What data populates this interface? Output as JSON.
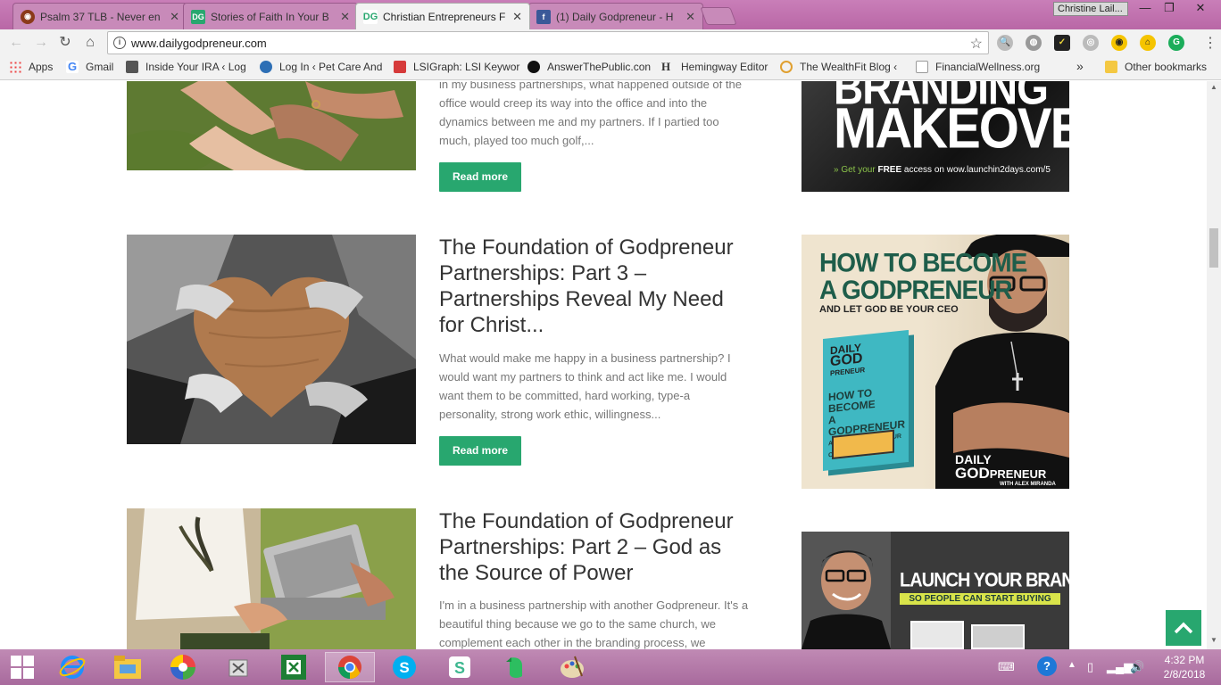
{
  "browser": {
    "tabs": [
      {
        "label": "Psalm 37 TLB - Never en",
        "active": false
      },
      {
        "label": "Stories of Faith In Your B",
        "active": false
      },
      {
        "label": "Christian Entrepreneurs F",
        "active": true
      },
      {
        "label": "(1) Daily Godpreneur - H",
        "active": false
      }
    ],
    "tab_icons": [
      "book-icon",
      "dg-icon",
      "dg-icon",
      "facebook-icon"
    ],
    "profile_name": "Christine Lail...",
    "window_controls": {
      "minimize": "—",
      "restore": "❐",
      "close": "✕"
    },
    "url": "www.dailygodpreneur.com",
    "bookmarks": [
      {
        "label": "Apps"
      },
      {
        "label": "Gmail"
      },
      {
        "label": "Inside Your IRA ‹ Log"
      },
      {
        "label": "Log In ‹ Pet Care And"
      },
      {
        "label": "LSIGraph: LSI Keywor"
      },
      {
        "label": "AnswerThePublic.con"
      },
      {
        "label": "Hemingway Editor"
      },
      {
        "label": "The WealthFit Blog ‹"
      },
      {
        "label": "FinancialWellness.org"
      }
    ],
    "bookmarks_overflow": "»",
    "other_bookmarks": "Other bookmarks"
  },
  "posts": [
    {
      "title": "",
      "excerpt": "in my business partnerships, what happened outside of the office would creep its way into the office and into the dynamics between me and my partners. If I partied too much, played too much golf,...",
      "read_more": "Read more"
    },
    {
      "title": "The Foundation of Godpreneur Partnerships: Part 3 – Partnerships Reveal My Need for Christ...",
      "excerpt": "What would make me happy in a business partnership? I would want my partners to think and act like me. I would want them to be committed, hard working, type-a personality, strong work ethic, willingness...",
      "read_more": "Read more"
    },
    {
      "title": "The Foundation of Godpreneur Partnerships: Part 2 – God as the Source of Power",
      "excerpt": "I'm in a business partnership with another Godpreneur. It's a beautiful thing because we go to the same church, we complement each other in the branding process, we",
      "read_more": ""
    }
  ],
  "ads": [
    {
      "headline_top": "BRANDING",
      "headline": "MAKEOVER",
      "cta_prefix": "» Get your ",
      "cta_bold": "FREE",
      "cta_suffix": " access on wow.launchin2days.com/5"
    },
    {
      "line1": "HOW TO BECOME",
      "line2": "A GODPRENEUR",
      "line3": "AND LET GOD BE YOUR CEO",
      "book_top": "DAILY",
      "book_mid": "GOD",
      "book_small": "PRENEUR",
      "book_title1": "HOW TO BECOME",
      "book_title2": "A GODPRENEUR",
      "book_sub": "AND LET GOD BE YOUR CEO",
      "logo_top": "DAILY",
      "logo_bottom_a": "GOD",
      "logo_bottom_b": "PRENEUR",
      "logo_small": "WITH ALEX MIRANDA"
    },
    {
      "line1": "LAUNCH YOUR BRAND",
      "line2": "SO PEOPLE CAN START BUYING"
    }
  ],
  "colors": {
    "accent_green": "#28a76f",
    "taskbar": "#b074a5",
    "ad_green": "#1e5d4a",
    "ad_yellow": "#d9e44a"
  },
  "taskbar": {
    "apps": [
      "windows-start-icon",
      "internet-explorer-icon",
      "file-explorer-icon",
      "picasa-icon",
      "tools-icon",
      "excel-icon",
      "chrome-icon",
      "skype-icon",
      "slack-icon",
      "evernote-icon",
      "paint-icon"
    ],
    "time": "4:32 PM",
    "date": "2/8/2018"
  }
}
